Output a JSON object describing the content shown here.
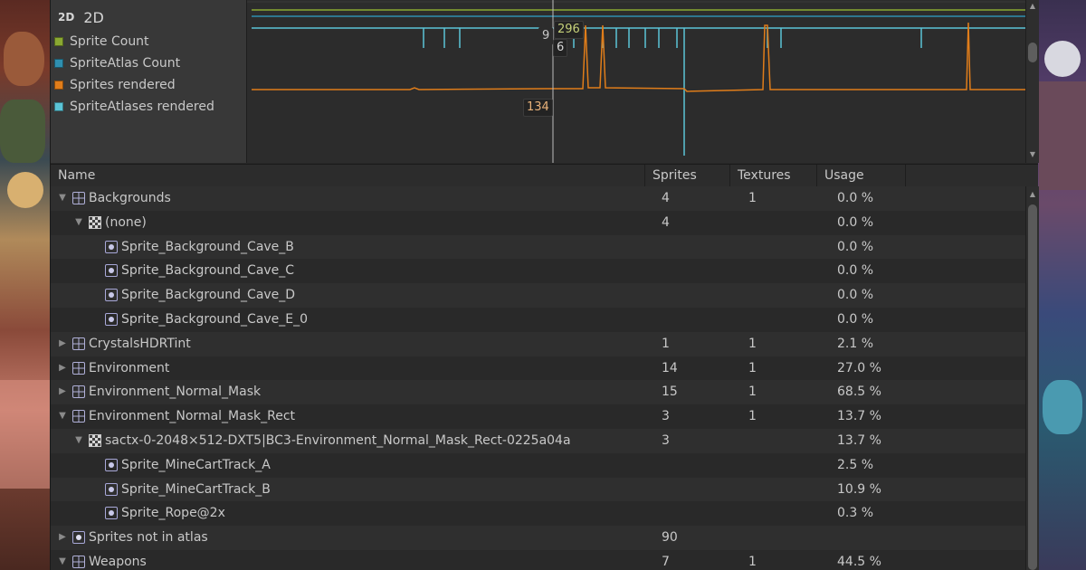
{
  "colors": {
    "sprite_count": "#8aa832",
    "spriteatlas_count": "#2f8fb0",
    "sprites_rendered": "#e07d1a",
    "spriteatlases_rendered": "#5bc4d6",
    "icon_purple": "#a8a8d8"
  },
  "module": {
    "badge": "2D",
    "title": "2D",
    "legend": [
      {
        "label": "Sprite Count",
        "color": "#8aa832"
      },
      {
        "label": "SpriteAtlas Count",
        "color": "#2f8fb0"
      },
      {
        "label": "Sprites rendered",
        "color": "#e07d1a"
      },
      {
        "label": "SpriteAtlases rendered",
        "color": "#5bc4d6"
      }
    ]
  },
  "chart_data": {
    "type": "line",
    "selected_frame_values": {
      "sprite_count": "296",
      "spriteatlas_count": "9",
      "spriteatlases_rendered": "6",
      "sprites_rendered": "134"
    },
    "series": [
      {
        "name": "Sprite Count"
      },
      {
        "name": "SpriteAtlas Count"
      },
      {
        "name": "Sprites rendered"
      },
      {
        "name": "SpriteAtlases rendered"
      }
    ]
  },
  "table": {
    "columns": [
      "Name",
      "Sprites",
      "Textures",
      "Usage"
    ],
    "rows": [
      {
        "depth": 0,
        "expanded": true,
        "icon": "atlas",
        "name": "Backgrounds",
        "sprites": "4",
        "textures": "1",
        "usage": "0.0 %"
      },
      {
        "depth": 1,
        "expanded": true,
        "icon": "texture",
        "name": "(none)",
        "sprites": "4",
        "textures": "",
        "usage": "0.0 %"
      },
      {
        "depth": 2,
        "expanded": null,
        "icon": "sprite",
        "name": "Sprite_Background_Cave_B",
        "sprites": "",
        "textures": "",
        "usage": "0.0 %"
      },
      {
        "depth": 2,
        "expanded": null,
        "icon": "sprite",
        "name": "Sprite_Background_Cave_C",
        "sprites": "",
        "textures": "",
        "usage": "0.0 %"
      },
      {
        "depth": 2,
        "expanded": null,
        "icon": "sprite",
        "name": "Sprite_Background_Cave_D",
        "sprites": "",
        "textures": "",
        "usage": "0.0 %"
      },
      {
        "depth": 2,
        "expanded": null,
        "icon": "sprite",
        "name": "Sprite_Background_Cave_E_0",
        "sprites": "",
        "textures": "",
        "usage": "0.0 %"
      },
      {
        "depth": 0,
        "expanded": false,
        "icon": "atlas",
        "name": "CrystalsHDRTint",
        "sprites": "1",
        "textures": "1",
        "usage": "2.1 %"
      },
      {
        "depth": 0,
        "expanded": false,
        "icon": "atlas",
        "name": "Environment",
        "sprites": "14",
        "textures": "1",
        "usage": "27.0 %"
      },
      {
        "depth": 0,
        "expanded": false,
        "icon": "atlas",
        "name": "Environment_Normal_Mask",
        "sprites": "15",
        "textures": "1",
        "usage": "68.5 %"
      },
      {
        "depth": 0,
        "expanded": true,
        "icon": "atlas",
        "name": "Environment_Normal_Mask_Rect",
        "sprites": "3",
        "textures": "1",
        "usage": "13.7 %"
      },
      {
        "depth": 1,
        "expanded": true,
        "icon": "texture",
        "name": "sactx-0-2048×512-DXT5|BC3-Environment_Normal_Mask_Rect-0225a04a",
        "sprites": "3",
        "textures": "",
        "usage": "13.7 %"
      },
      {
        "depth": 2,
        "expanded": null,
        "icon": "sprite",
        "name": "Sprite_MineCartTrack_A",
        "sprites": "",
        "textures": "",
        "usage": "2.5 %"
      },
      {
        "depth": 2,
        "expanded": null,
        "icon": "sprite",
        "name": "Sprite_MineCartTrack_B",
        "sprites": "",
        "textures": "",
        "usage": "10.9 %"
      },
      {
        "depth": 2,
        "expanded": null,
        "icon": "sprite",
        "name": "Sprite_Rope@2x",
        "sprites": "",
        "textures": "",
        "usage": "0.3 %"
      },
      {
        "depth": 0,
        "expanded": false,
        "icon": "loose",
        "name": "Sprites not in atlas",
        "sprites": "90",
        "textures": "",
        "usage": ""
      },
      {
        "depth": 0,
        "expanded": true,
        "icon": "atlas",
        "name": "Weapons",
        "sprites": "7",
        "textures": "1",
        "usage": "44.5 %"
      }
    ]
  }
}
